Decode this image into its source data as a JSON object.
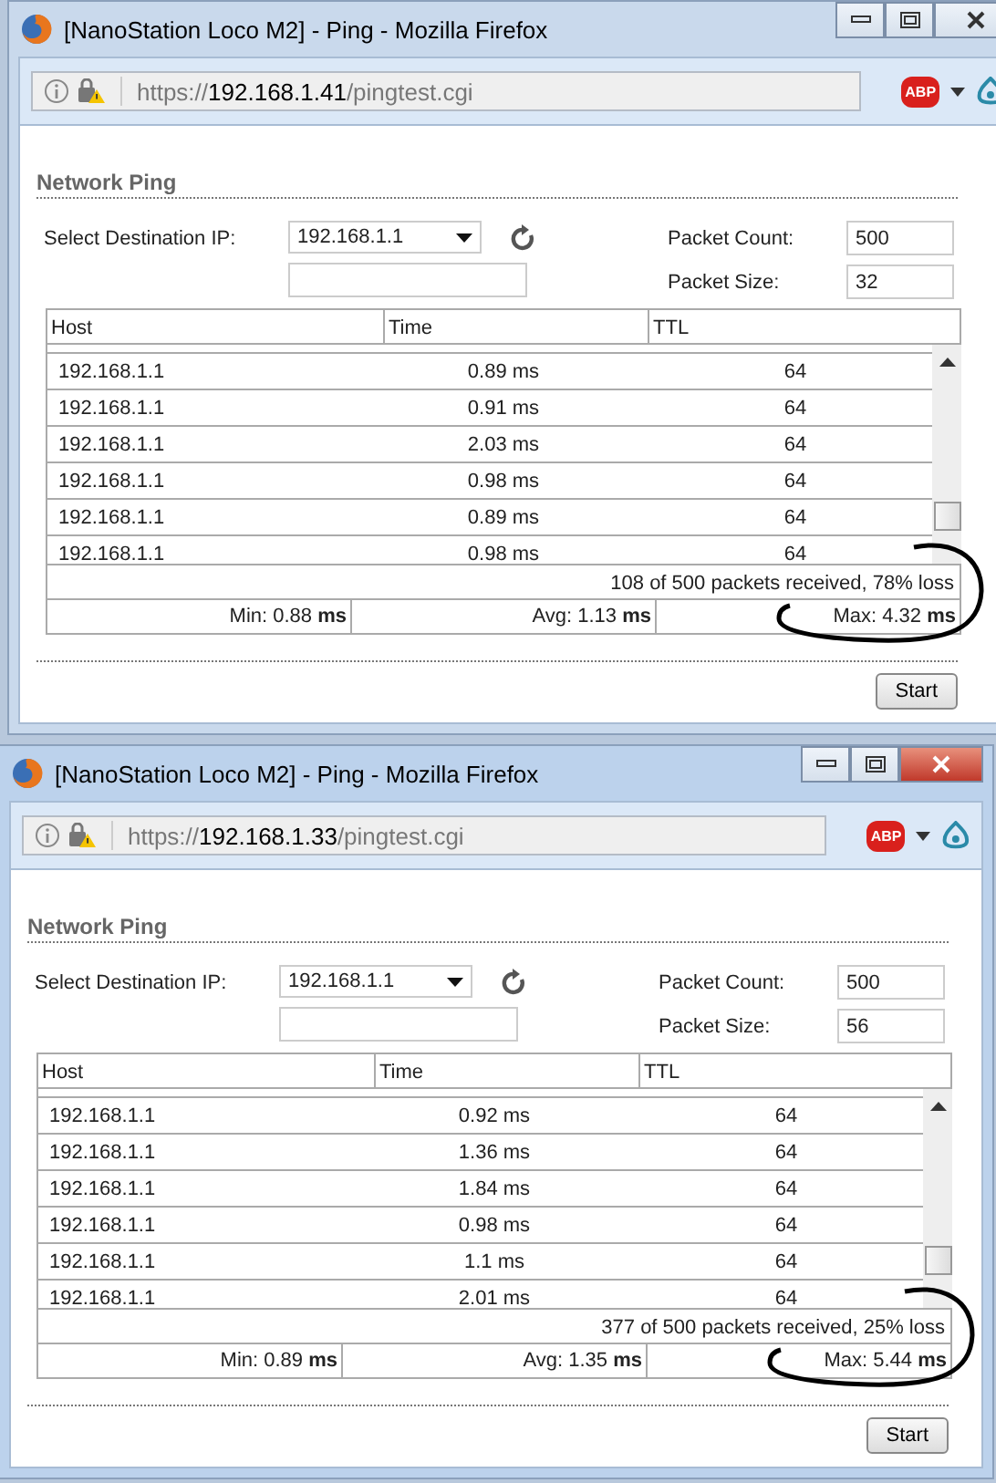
{
  "windows": [
    {
      "title": "[NanoStation Loco M2] - Ping - Mozilla Firefox",
      "active": false,
      "url": {
        "scheme": "https://",
        "host": "192.168.1.41",
        "path": "/pingtest.cgi"
      },
      "abp_label": "ABP",
      "heading": "Network Ping",
      "dest_label": "Select Destination IP:",
      "dest_value": "192.168.1.1",
      "count_label": "Packet Count:",
      "count_value": "500",
      "size_label": "Packet Size:",
      "size_value": "32",
      "columns": [
        "Host",
        "Time",
        "TTL"
      ],
      "rows": [
        {
          "host": "192.168.1.1",
          "time": "0.89 ms",
          "ttl": "64"
        },
        {
          "host": "192.168.1.1",
          "time": "0.91 ms",
          "ttl": "64"
        },
        {
          "host": "192.168.1.1",
          "time": "2.03 ms",
          "ttl": "64"
        },
        {
          "host": "192.168.1.1",
          "time": "0.98 ms",
          "ttl": "64"
        },
        {
          "host": "192.168.1.1",
          "time": "0.89 ms",
          "ttl": "64"
        },
        {
          "host": "192.168.1.1",
          "time": "0.98 ms",
          "ttl": "64"
        }
      ],
      "summary": "108 of 500 packets received, 78% loss",
      "stats": [
        "Min: 0.88 **ms**",
        "Avg: 1.13 **ms**",
        "Max: 4.32 **ms**"
      ],
      "start_button": "Start",
      "annotation": {
        "kind": "circle"
      }
    },
    {
      "title": "[NanoStation Loco M2] - Ping - Mozilla Firefox",
      "active": true,
      "url": {
        "scheme": "https://",
        "host": "192.168.1.33",
        "path": "/pingtest.cgi"
      },
      "abp_label": "ABP",
      "heading": "Network Ping",
      "dest_label": "Select Destination IP:",
      "dest_value": "192.168.1.1",
      "count_label": "Packet Count:",
      "count_value": "500",
      "size_label": "Packet Size:",
      "size_value": "56",
      "columns": [
        "Host",
        "Time",
        "TTL"
      ],
      "rows": [
        {
          "host": "192.168.1.1",
          "time": "0.92 ms",
          "ttl": "64"
        },
        {
          "host": "192.168.1.1",
          "time": "1.36 ms",
          "ttl": "64"
        },
        {
          "host": "192.168.1.1",
          "time": "1.84 ms",
          "ttl": "64"
        },
        {
          "host": "192.168.1.1",
          "time": "0.98 ms",
          "ttl": "64"
        },
        {
          "host": "192.168.1.1",
          "time": "1.1 ms",
          "ttl": "64"
        },
        {
          "host": "192.168.1.1",
          "time": "2.01 ms",
          "ttl": "64"
        }
      ],
      "summary": "377 of 500 packets received, 25% loss",
      "stats": [
        "Min: 0.89 **ms**",
        "Avg: 1.35 **ms**",
        "Max: 5.44 **ms**"
      ],
      "start_button": "Start",
      "annotation": {
        "kind": "circle"
      }
    }
  ]
}
